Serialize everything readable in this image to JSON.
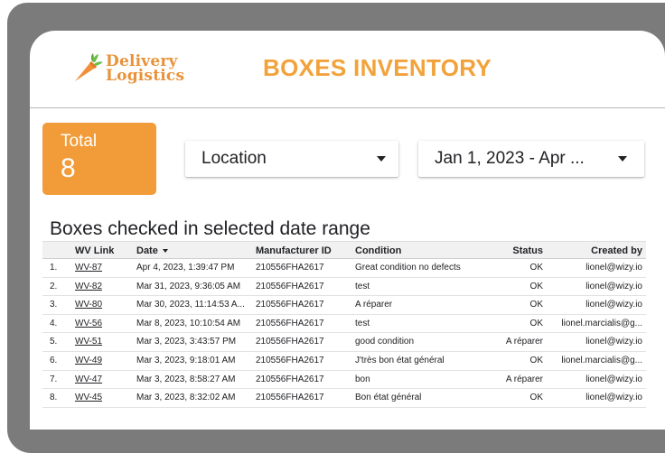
{
  "header": {
    "logo_line1": "Delivery",
    "logo_line2": "Logistics",
    "title": "BOXES INVENTORY"
  },
  "kpi": {
    "label": "Total",
    "value": "8"
  },
  "filters": {
    "location": "Location",
    "date_range": "Jan 1, 2023 - Apr ..."
  },
  "table": {
    "title": "Boxes checked in selected date range",
    "columns": {
      "link": "WV Link",
      "date": "Date",
      "manufacturer": "Manufacturer ID",
      "condition": "Condition",
      "status": "Status",
      "created_by": "Created by"
    },
    "rows": [
      {
        "num": "1.",
        "link": "WV-87",
        "date": "Apr 4, 2023, 1:39:47 PM",
        "manufacturer": "210556FHA2617",
        "condition": "Great condition no defects",
        "status": "OK",
        "created_by": "lionel@wizy.io"
      },
      {
        "num": "2.",
        "link": "WV-82",
        "date": "Mar 31, 2023, 9:36:05 AM",
        "manufacturer": "210556FHA2617",
        "condition": "test",
        "status": "OK",
        "created_by": "lionel@wizy.io"
      },
      {
        "num": "3.",
        "link": "WV-80",
        "date": "Mar 30, 2023, 11:14:53 A...",
        "manufacturer": "210556FHA2617",
        "condition": "A réparer",
        "status": "OK",
        "created_by": "lionel@wizy.io"
      },
      {
        "num": "4.",
        "link": "WV-56",
        "date": "Mar 8, 2023, 10:10:54 AM",
        "manufacturer": "210556FHA2617",
        "condition": "test",
        "status": "OK",
        "created_by": "lionel.marcialis@g..."
      },
      {
        "num": "5.",
        "link": "WV-51",
        "date": "Mar 3, 2023, 3:43:57 PM",
        "manufacturer": "210556FHA2617",
        "condition": "good condition",
        "status": "A réparer",
        "created_by": "lionel@wizy.io"
      },
      {
        "num": "6.",
        "link": "WV-49",
        "date": "Mar 3, 2023, 9:18:01 AM",
        "manufacturer": "210556FHA2617",
        "condition": "J'très bon état général",
        "status": "OK",
        "created_by": "lionel.marcialis@g..."
      },
      {
        "num": "7.",
        "link": "WV-47",
        "date": "Mar 3, 2023, 8:58:27 AM",
        "manufacturer": "210556FHA2617",
        "condition": "bon",
        "status": "A réparer",
        "created_by": "lionel@wizy.io"
      },
      {
        "num": "8.",
        "link": "WV-45",
        "date": "Mar 3, 2023, 8:32:02 AM",
        "manufacturer": "210556FHA2617",
        "condition": "Bon état général",
        "status": "OK",
        "created_by": "lionel@wizy.io"
      }
    ]
  },
  "icons": {
    "logo": "carrot-icon",
    "dropdown": "caret-down-icon",
    "sort": "sort-desc-icon"
  },
  "colors": {
    "brand_orange": "#f19c38",
    "title_orange": "#f2a23a",
    "frame_gray": "#7b7b7b"
  }
}
